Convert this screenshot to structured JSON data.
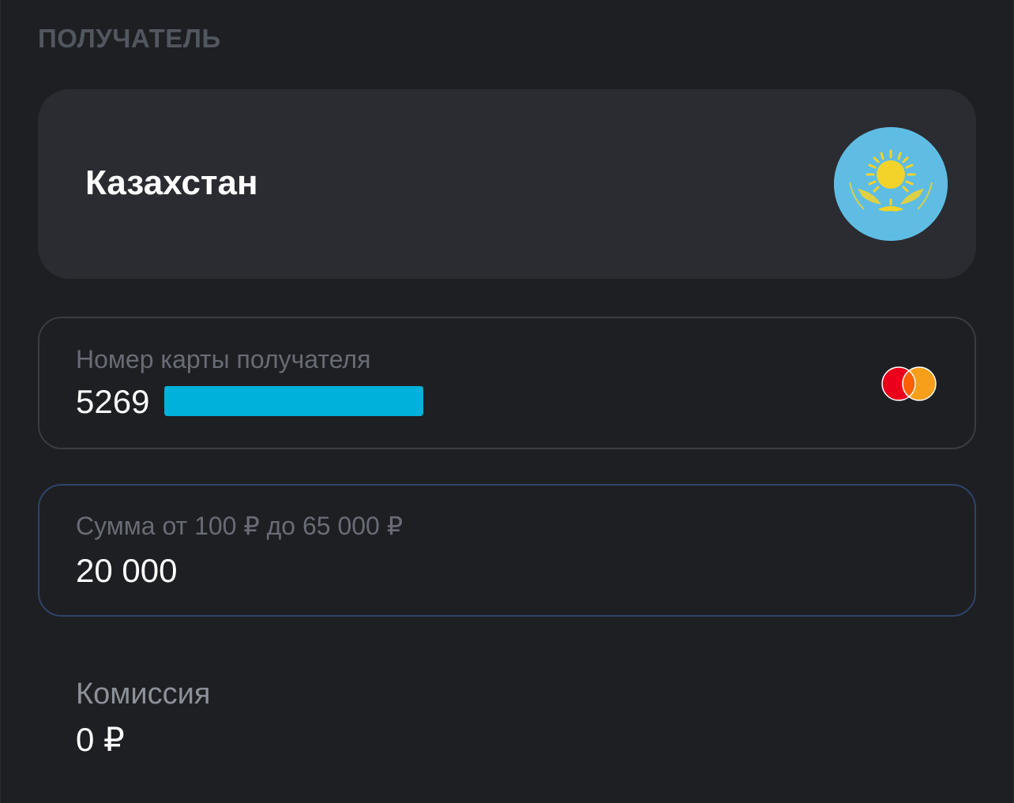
{
  "recipient_section": {
    "title": "ПОЛУЧАТЕЛЬ"
  },
  "country": {
    "name": "Казахстан",
    "flag_icon": "kazakhstan-flag-icon",
    "flag_color": "#5fbde3"
  },
  "card_field": {
    "label": "Номер карты получателя",
    "value_visible": "5269",
    "card_brand_icon": "mastercard-icon"
  },
  "amount_field": {
    "label": "Сумма от 100 ₽ до 65 000 ₽",
    "value": "20 000"
  },
  "fee": {
    "label": "Комиссия",
    "value": "0 ₽"
  },
  "colors": {
    "background": "#1e1f23",
    "card_background": "#2a2c31",
    "active_border": "#2e4469",
    "redaction": "#00b1dc"
  }
}
